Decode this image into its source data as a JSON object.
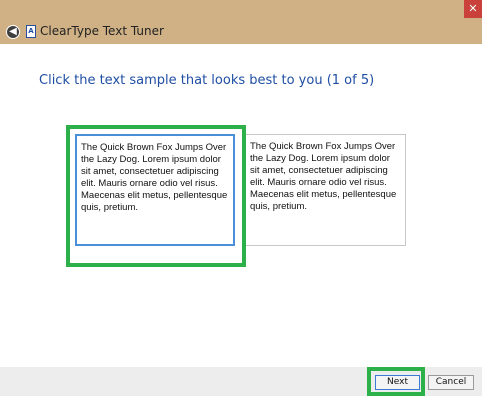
{
  "window": {
    "title": "ClearType Text Tuner",
    "close_glyph": "✕",
    "back_glyph": "◀",
    "icon_text": "A"
  },
  "main": {
    "instruction": "Click the text sample that looks best to you (1 of 5)"
  },
  "samples": [
    {
      "text": "The Quick Brown Fox Jumps Over the Lazy Dog. Lorem ipsum dolor sit amet, consectetuer adipiscing elit. Mauris ornare odio vel risus. Maecenas elit metus, pellentesque quis, pretium.",
      "selected": true
    },
    {
      "text": "The Quick Brown Fox Jumps Over the Lazy Dog. Lorem ipsum dolor sit amet, consectetuer adipiscing elit. Mauris ornare odio vel risus. Maecenas elit metus, pellentesque quis, pretium.",
      "selected": false
    }
  ],
  "footer": {
    "next_label": "Next",
    "cancel_label": "Cancel"
  },
  "colors": {
    "title_strip": "#d0b185",
    "instruction_text": "#1f4ea3",
    "highlight": "#2bb04a",
    "selected_border": "#4a90d9"
  }
}
